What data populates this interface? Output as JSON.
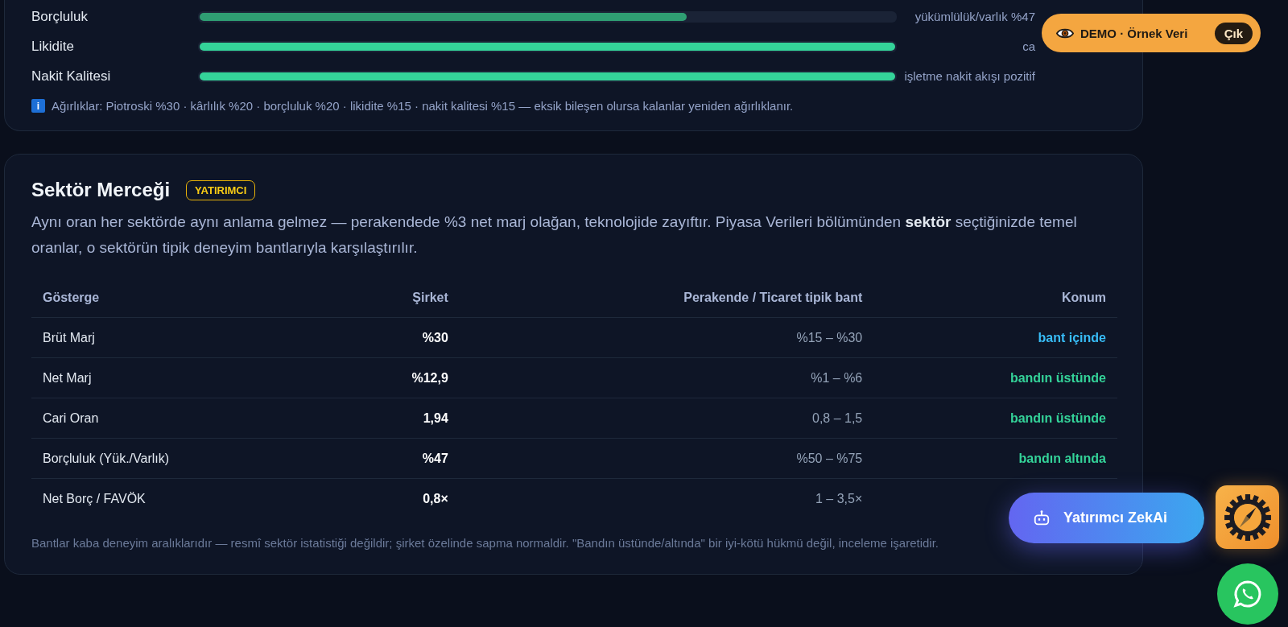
{
  "score_card": {
    "metrics": [
      {
        "label": "Borçluluk",
        "level": 0.7,
        "color": "#2f9e73",
        "note": "yükümlülük/varlık %47"
      },
      {
        "label": "Likidite",
        "level": 1,
        "color": "#34d399",
        "note": "ca"
      },
      {
        "label": "Nakit Kalitesi",
        "level": 1,
        "color": "#34d399",
        "note": "işletme nakit akışı pozitif"
      }
    ],
    "info_icon": "i",
    "weights_note": "Ağırlıklar: Piotroski %30 · kârlılık %20 · borçluluk %20 · likidite %15 · nakit kalitesi %15 — eksik bileşen olursa kalanlar yeniden ağırlıklanır."
  },
  "sector_card": {
    "title": "Sektör Merceği",
    "badge": "YATIRIMCI",
    "description": "Aynı oran her sektörde aynı anlama gelmez — perakendede %3 net marj olağan, teknolojide zayıftır. Piyasa Verileri bölümünden **sektör** seçtiğinizde temel oranlar, o sektörün tipik deneyim bantlarıyla karşılaştırılır.",
    "table": {
      "columns": [
        "Gösterge",
        "Şirket",
        "Perakende / Ticaret tipik bant",
        "Konum"
      ],
      "rows": [
        {
          "indicator": "Brüt Marj",
          "company": "%30",
          "band": "%15 – %30",
          "position": "bant içinde",
          "color": "#38bdf8"
        },
        {
          "indicator": "Net Marj",
          "company": "%12,9",
          "band": "%1 – %6",
          "position": "bandın üstünde",
          "color": "#34d399"
        },
        {
          "indicator": "Cari Oran",
          "company": "1,94",
          "band": "0,8 – 1,5",
          "position": "bandın üstünde",
          "color": "#34d399"
        },
        {
          "indicator": "Borçluluk (Yük./Varlık)",
          "company": "%47",
          "band": "%50 – %75",
          "position": "bandın altında",
          "color": "#34d399"
        },
        {
          "indicator": "Net Borç / FAVÖK",
          "company": "0,8×",
          "band": "1 – 3,5×"
        }
      ]
    },
    "footnote": "Bantlar kaba deneyim aralıklarıdır — resmî sektör istatistiği değildir; şirket özelinde sapma normaldir. \"Bandın üstünde/altında\" bir iyi-kötü hükmü değil, inceleme işaretidir."
  },
  "demo_banner": {
    "label": "DEMO · Örnek Veri",
    "exit": "Çık"
  },
  "assistant_button": "Yatırımcı ZekAi"
}
